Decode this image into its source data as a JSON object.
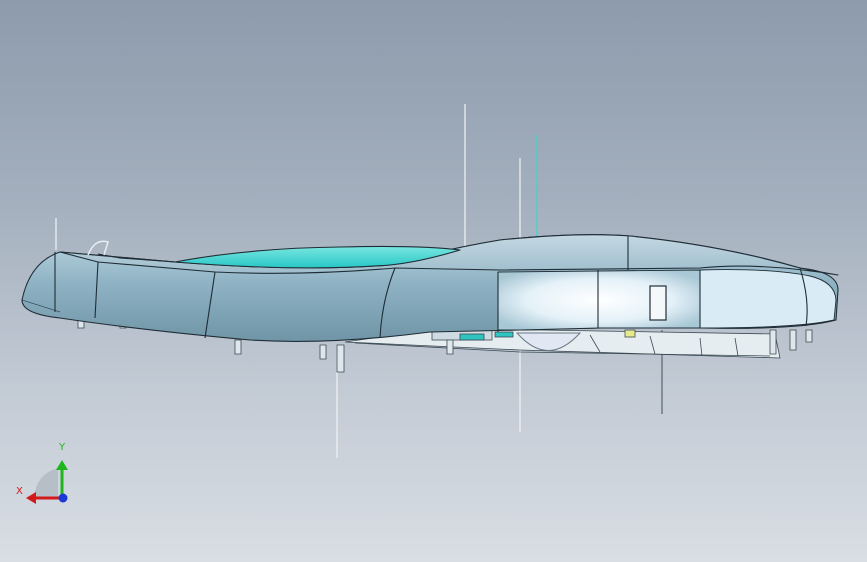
{
  "axis_triad": {
    "x_label": "X",
    "y_label": "Y",
    "x_color": "#d21a1a",
    "y_color": "#1fb51f",
    "z_color": "#1a3ad8"
  },
  "colors": {
    "background_top": "#8d9bac",
    "background_bottom": "#d9dee4",
    "body_shell": "#8fb3c4",
    "body_highlight": "#e9f4fb",
    "cyan_glass": "#3fd4d0",
    "edge": "#1f2d36"
  }
}
